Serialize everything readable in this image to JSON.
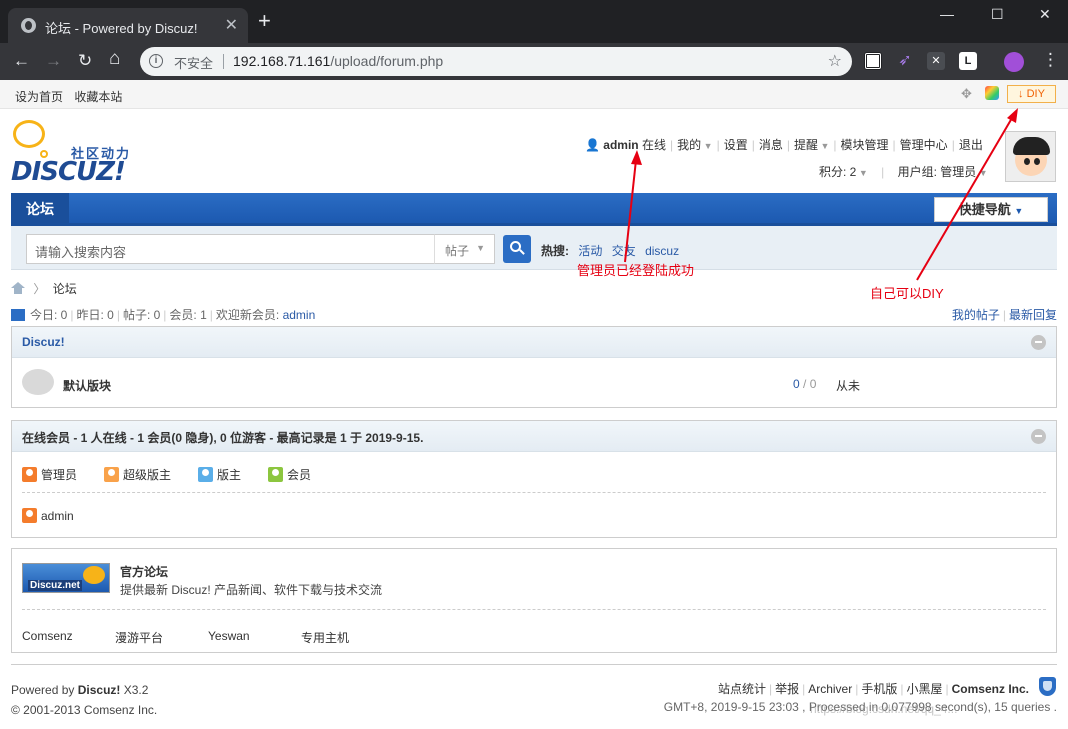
{
  "browser": {
    "tab_title": "论坛 - Powered by Discuz!",
    "tab_close": "✕",
    "new_tab": "+",
    "minimize": "—",
    "maximize": "☐",
    "close": "✕",
    "back": "←",
    "forward": "→",
    "reload": "↻",
    "home": "⌂",
    "info_icon": "i",
    "insecure_label": "不安全",
    "url_host": "192.168.71.161",
    "url_path": "/upload/forum.php",
    "star": "☆",
    "menu": "⋮"
  },
  "topbar": {
    "set_home": "设为首页",
    "bookmark": "收藏本站",
    "diy_label": "DIY"
  },
  "logo": {
    "text": "DISCUZ!",
    "tagline": "社区动力"
  },
  "user": {
    "name": "admin",
    "status": "在线",
    "mine": "我的",
    "settings": "设置",
    "messages": "消息",
    "reminders": "提醒",
    "module_mgmt": "模块管理",
    "admin_center": "管理中心",
    "logout": "退出",
    "points": "积分: 2",
    "usergroup": "用户组: 管理员"
  },
  "nav": {
    "current_tab": "论坛",
    "quick_nav": "快捷导航"
  },
  "search": {
    "placeholder": "请输入搜索内容",
    "scope": "帖子",
    "hot_label": "热搜:",
    "hot_keywords": [
      "活动",
      "交友",
      "discuz"
    ]
  },
  "annotations": {
    "admin_login": "管理员已经登陆成功",
    "diy": "自己可以DIY"
  },
  "breadcrumb": {
    "current": "论坛"
  },
  "stats": {
    "today": "今日: 0",
    "yesterday": "昨日: 0",
    "posts": "帖子: 0",
    "members": "会员: 1",
    "welcome": "欢迎新会员:",
    "newest_member": "admin",
    "my_posts": "我的帖子",
    "latest_replies": "最新回复"
  },
  "category": {
    "title": "Discuz!",
    "forum_name": "默认版块",
    "threads": "0",
    "sep": "/",
    "posts": "0",
    "last_post": "从未"
  },
  "online": {
    "title": "在线会员 - 1 人在线 - 1 会员(0 隐身), 0 位游客 - 最高记录是 1 于 2019-9-15.",
    "legend": [
      {
        "label": "管理员",
        "color": "#f47c2c"
      },
      {
        "label": "超级版主",
        "color": "#f9a24a"
      },
      {
        "label": "版主",
        "color": "#5aaee8"
      },
      {
        "label": "会员",
        "color": "#8cc63f"
      }
    ],
    "users": [
      "admin"
    ]
  },
  "links": {
    "logo_text": "Discuz.net",
    "title": "官方论坛",
    "desc": "提供最新 Discuz! 产品新闻、软件下载与技术交流",
    "partners": [
      "Comsenz",
      "漫游平台",
      "Yeswan",
      "专用主机"
    ]
  },
  "footer": {
    "powered": "Powered by",
    "product": "Discuz!",
    "version": "X3.2",
    "copyright": "© 2001-2013 Comsenz Inc.",
    "links": [
      "站点统计",
      "举报",
      "Archiver",
      "手机版",
      "小黑屋"
    ],
    "company": "Comsenz Inc.",
    "debug": "GMT+8, 2019-9-15 23:03 , Processed in 0.077998 second(s), 15 queries .",
    "watermark": "https://blog.csdn.net/qq_4..."
  }
}
